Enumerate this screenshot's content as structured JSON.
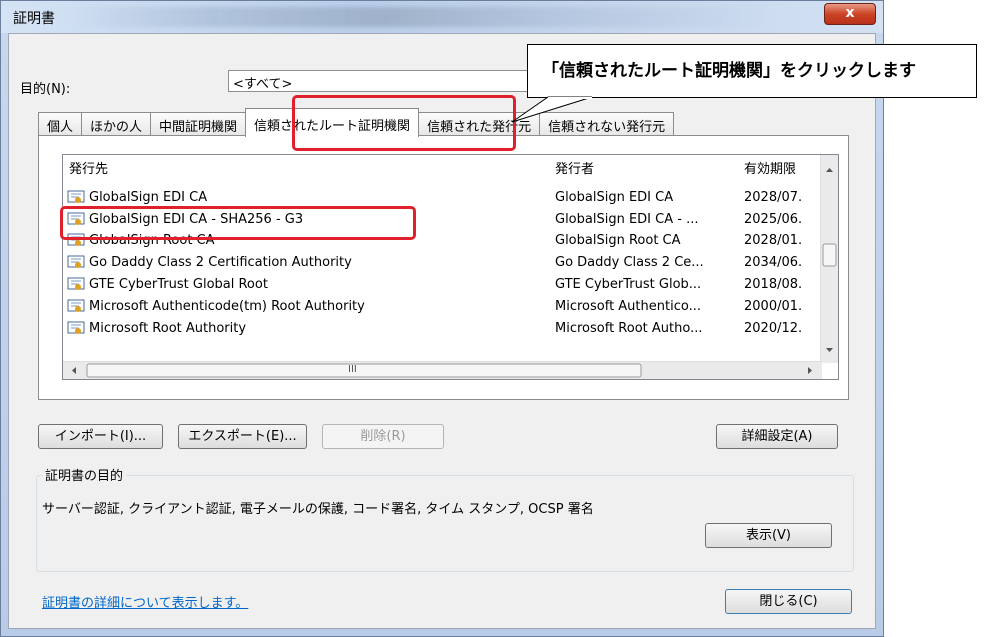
{
  "window": {
    "title": "証明書",
    "close_glyph": "x"
  },
  "purpose": {
    "label": "目的(N):",
    "selected": "<すべて>"
  },
  "tabs": [
    {
      "label": "個人"
    },
    {
      "label": "ほかの人"
    },
    {
      "label": "中間証明機関"
    },
    {
      "label": "信頼されたルート証明機関"
    },
    {
      "label": "信頼された発行元"
    },
    {
      "label": "信頼されない発行元"
    }
  ],
  "list": {
    "columns": {
      "issued_to": "発行先",
      "issued_by": "発行者",
      "expires": "有効期限"
    },
    "rows": [
      {
        "to": "GlobalSign EDI CA",
        "by": "GlobalSign EDI CA",
        "exp": "2028/07."
      },
      {
        "to": "GlobalSign EDI CA - SHA256 - G3",
        "by": "GlobalSign EDI CA - ...",
        "exp": "2025/06."
      },
      {
        "to": "GlobalSign Root CA",
        "by": "GlobalSign Root CA",
        "exp": "2028/01."
      },
      {
        "to": "Go Daddy Class 2 Certification Authority",
        "by": "Go Daddy Class 2 Ce...",
        "exp": "2034/06."
      },
      {
        "to": "GTE CyberTrust Global Root",
        "by": "GTE CyberTrust Glob...",
        "exp": "2018/08."
      },
      {
        "to": "Microsoft Authenticode(tm) Root Authority",
        "by": "Microsoft Authentico...",
        "exp": "2000/01."
      },
      {
        "to": "Microsoft Root Authority",
        "by": "Microsoft Root Autho...",
        "exp": "2020/12."
      }
    ],
    "hscroll_thumb_glyph": "III"
  },
  "buttons": {
    "import": "インポート(I)...",
    "export": "エクスポート(E)...",
    "delete": "削除(R)",
    "advanced": "詳細設定(A)",
    "view": "表示(V)",
    "close": "閉じる(C)"
  },
  "purposes_group": {
    "label": "証明書の目的",
    "text": "サーバー認証, クライアント認証, 電子メールの保護, コード署名, タイム スタンプ, OCSP 署名"
  },
  "details_link": "証明書の詳細について表示します。",
  "callout": {
    "text": "「信頼されたルート証明機関」をクリックします"
  },
  "colors": {
    "highlight": "#e0212b",
    "link": "#0066cc",
    "selected_row": "#ffffff"
  }
}
